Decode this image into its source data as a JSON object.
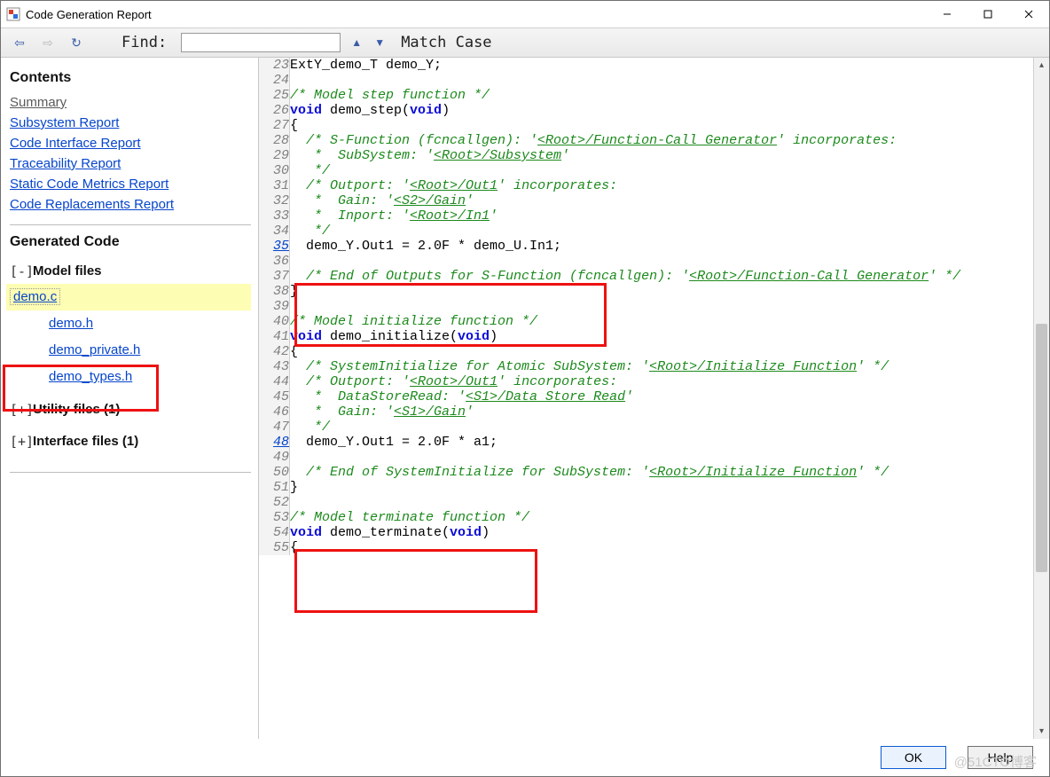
{
  "window": {
    "title": "Code Generation Report"
  },
  "toolbar": {
    "find_label": "Find:",
    "find_value": "",
    "match_case": "Match Case"
  },
  "sidebar": {
    "contents_title": "Contents",
    "links": {
      "summary": "Summary",
      "subsystem": "Subsystem Report",
      "code_interface": "Code Interface Report",
      "traceability": "Traceability Report",
      "static_metrics": "Static Code Metrics Report",
      "code_replacements": "Code Replacements Report"
    },
    "generated_title": "Generated Code",
    "tree": {
      "model_files": {
        "toggle": "[-]",
        "label": "Model files",
        "items": [
          "demo.c",
          "demo.h",
          "demo_private.h",
          "demo_types.h"
        ]
      },
      "utility_files": {
        "toggle": "[+]",
        "label": "Utility files (1)"
      },
      "interface_files": {
        "toggle": "[+]",
        "label": "Interface files (1)"
      }
    }
  },
  "code": {
    "lines": [
      {
        "n": 23,
        "link": false,
        "seg": [
          [
            "p",
            "ExtY_demo_T demo_Y;"
          ]
        ]
      },
      {
        "n": 24,
        "link": false,
        "seg": []
      },
      {
        "n": 25,
        "link": false,
        "seg": [
          [
            "c",
            "/* Model step function */"
          ]
        ]
      },
      {
        "n": 26,
        "link": false,
        "seg": [
          [
            "k",
            "void"
          ],
          [
            "p",
            " demo_step("
          ],
          [
            "k",
            "void"
          ],
          [
            "p",
            ")"
          ]
        ]
      },
      {
        "n": 27,
        "link": false,
        "seg": [
          [
            "p",
            "{"
          ]
        ]
      },
      {
        "n": 28,
        "link": false,
        "seg": [
          [
            "c",
            "  /* S-Function (fcncallgen): '"
          ],
          [
            "u",
            "<Root>/Function-Call Generator"
          ],
          [
            "c",
            "' incorporates:"
          ]
        ]
      },
      {
        "n": 29,
        "link": false,
        "seg": [
          [
            "c",
            "   *  SubSystem: '"
          ],
          [
            "u",
            "<Root>/Subsystem"
          ],
          [
            "c",
            "'"
          ]
        ]
      },
      {
        "n": 30,
        "link": false,
        "seg": [
          [
            "c",
            "   */"
          ]
        ]
      },
      {
        "n": 31,
        "link": false,
        "seg": [
          [
            "c",
            "  /* Outport: '"
          ],
          [
            "u",
            "<Root>/Out1"
          ],
          [
            "c",
            "' incorporates:"
          ]
        ]
      },
      {
        "n": 32,
        "link": false,
        "seg": [
          [
            "c",
            "   *  Gain: '"
          ],
          [
            "u",
            "<S2>/Gain"
          ],
          [
            "c",
            "'"
          ]
        ]
      },
      {
        "n": 33,
        "link": false,
        "seg": [
          [
            "c",
            "   *  Inport: '"
          ],
          [
            "u",
            "<Root>/In1"
          ],
          [
            "c",
            "'"
          ]
        ]
      },
      {
        "n": 34,
        "link": false,
        "seg": [
          [
            "c",
            "   */"
          ]
        ]
      },
      {
        "n": 35,
        "link": true,
        "seg": [
          [
            "p",
            "  demo_Y.Out1 = 2.0F * demo_U.In1;"
          ]
        ]
      },
      {
        "n": 36,
        "link": false,
        "seg": []
      },
      {
        "n": 37,
        "link": false,
        "seg": [
          [
            "c",
            "  /* End of Outputs for S-Function (fcncallgen): '"
          ],
          [
            "u",
            "<Root>/Function-Call Generator"
          ],
          [
            "c",
            "' */"
          ]
        ]
      },
      {
        "n": 38,
        "link": false,
        "seg": [
          [
            "p",
            "}"
          ]
        ]
      },
      {
        "n": 39,
        "link": false,
        "seg": []
      },
      {
        "n": 40,
        "link": false,
        "seg": [
          [
            "c",
            "/* Model initialize function */"
          ]
        ]
      },
      {
        "n": 41,
        "link": false,
        "seg": [
          [
            "k",
            "void"
          ],
          [
            "p",
            " demo_initialize("
          ],
          [
            "k",
            "void"
          ],
          [
            "p",
            ")"
          ]
        ]
      },
      {
        "n": 42,
        "link": false,
        "seg": [
          [
            "p",
            "{"
          ]
        ]
      },
      {
        "n": 43,
        "link": false,
        "seg": [
          [
            "c",
            "  /* SystemInitialize for Atomic SubSystem: '"
          ],
          [
            "u",
            "<Root>/Initialize Function"
          ],
          [
            "c",
            "' */"
          ]
        ]
      },
      {
        "n": 44,
        "link": false,
        "seg": [
          [
            "c",
            "  /* Outport: '"
          ],
          [
            "u",
            "<Root>/Out1"
          ],
          [
            "c",
            "' incorporates:"
          ]
        ]
      },
      {
        "n": 45,
        "link": false,
        "seg": [
          [
            "c",
            "   *  DataStoreRead: '"
          ],
          [
            "u",
            "<S1>/Data Store Read"
          ],
          [
            "c",
            "'"
          ]
        ]
      },
      {
        "n": 46,
        "link": false,
        "seg": [
          [
            "c",
            "   *  Gain: '"
          ],
          [
            "u",
            "<S1>/Gain"
          ],
          [
            "c",
            "'"
          ]
        ]
      },
      {
        "n": 47,
        "link": false,
        "seg": [
          [
            "c",
            "   */"
          ]
        ]
      },
      {
        "n": 48,
        "link": true,
        "seg": [
          [
            "p",
            "  demo_Y.Out1 = 2.0F * a1;"
          ]
        ]
      },
      {
        "n": 49,
        "link": false,
        "seg": []
      },
      {
        "n": 50,
        "link": false,
        "seg": [
          [
            "c",
            "  /* End of SystemInitialize for SubSystem: '"
          ],
          [
            "u",
            "<Root>/Initialize Function"
          ],
          [
            "c",
            "' */"
          ]
        ]
      },
      {
        "n": 51,
        "link": false,
        "seg": [
          [
            "p",
            "}"
          ]
        ]
      },
      {
        "n": 52,
        "link": false,
        "seg": []
      },
      {
        "n": 53,
        "link": false,
        "seg": [
          [
            "c",
            "/* Model terminate function */"
          ]
        ]
      },
      {
        "n": 54,
        "link": false,
        "seg": [
          [
            "k",
            "void"
          ],
          [
            "p",
            " demo_terminate("
          ],
          [
            "k",
            "void"
          ],
          [
            "p",
            ")"
          ]
        ]
      },
      {
        "n": 55,
        "link": false,
        "seg": [
          [
            "p",
            "{"
          ]
        ]
      }
    ]
  },
  "buttons": {
    "ok": "OK",
    "help": "Help"
  },
  "watermark": "@51CTO博客"
}
